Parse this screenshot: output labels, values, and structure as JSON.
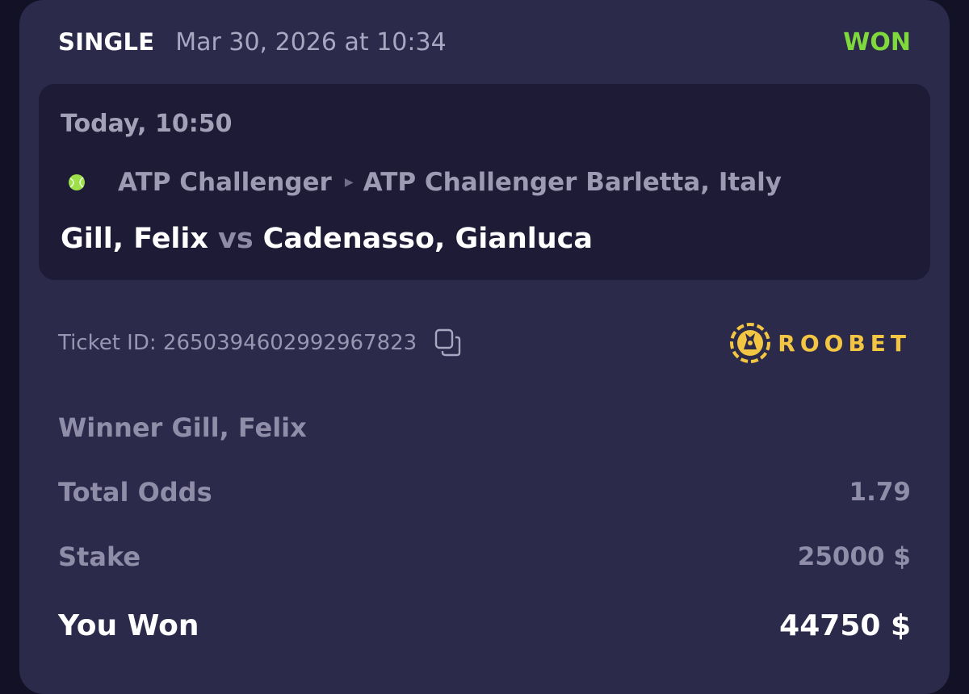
{
  "header": {
    "type": "SINGLE",
    "date": "Mar 30, 2026 at 10:34",
    "status": "WON"
  },
  "event": {
    "time": "Today, 10:50",
    "league": "ATP Challenger",
    "tournament": "ATP Challenger Barletta, Italy",
    "player1": "Gill, Felix",
    "vs": "vs",
    "player2": "Cadenasso, Gianluca"
  },
  "ticket": {
    "label": "Ticket ID: 2650394602992967823"
  },
  "brand": {
    "name": "ROOBET"
  },
  "selection": "Winner Gill, Felix",
  "summary": {
    "odds_label": "Total Odds",
    "odds_value": "1.79",
    "stake_label": "Stake",
    "stake_value": "25000 $",
    "won_label": "You Won",
    "won_value": "44750 $"
  },
  "colors": {
    "background": "#121125",
    "card": "#2c2a4a",
    "event_panel": "#1d1b35",
    "status_won": "#7fd83c",
    "brand": "#f2c542"
  },
  "icons": {
    "sport": "tennis-ball-icon",
    "breadcrumb": "caret-right-icon",
    "copy": "copy-icon",
    "brand_logo": "roobet-logo"
  }
}
